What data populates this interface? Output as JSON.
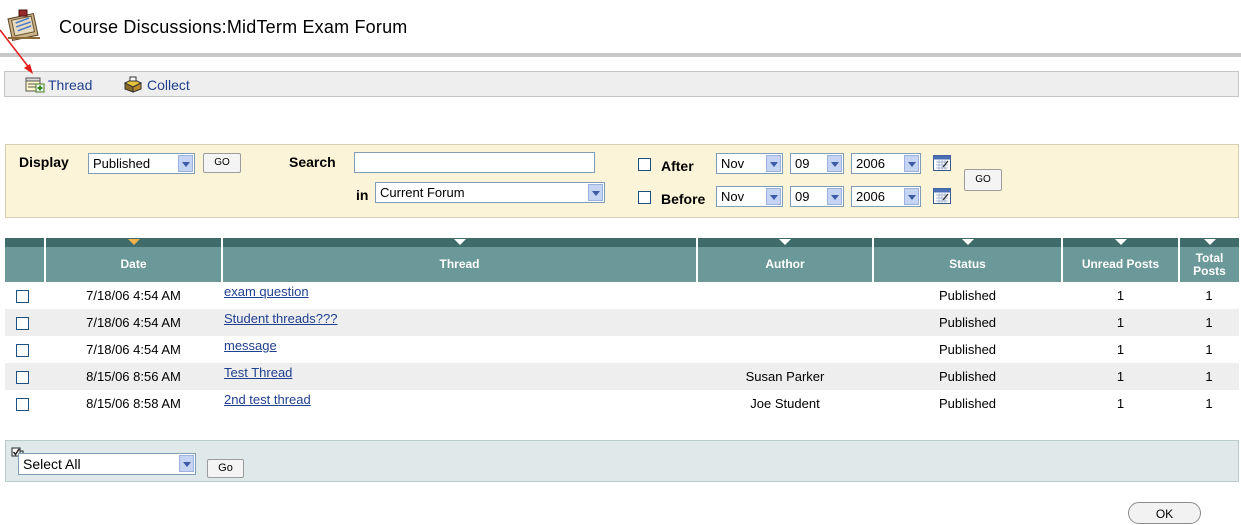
{
  "header": {
    "title": "Course Discussions:MidTerm Exam Forum"
  },
  "actions": {
    "thread_label": "Thread",
    "collect_label": "Collect"
  },
  "filter": {
    "display_label": "Display",
    "display_value": "Published",
    "display_go": "GO",
    "search_label": "Search",
    "search_value": "",
    "in_label": "in",
    "in_value": "Current Forum",
    "after_label": "After",
    "before_label": "Before",
    "after_month": "Nov",
    "after_day": "09",
    "after_year": "2006",
    "before_month": "Nov",
    "before_day": "09",
    "before_year": "2006",
    "date_go": "GO"
  },
  "table": {
    "columns": {
      "date": "Date",
      "thread": "Thread",
      "author": "Author",
      "status": "Status",
      "unread": "Unread Posts",
      "total": "Total Posts"
    },
    "rows": [
      {
        "date": "7/18/06 4:54 AM",
        "thread": "exam question",
        "author": "",
        "status": "Published",
        "unread": "1",
        "total": "1"
      },
      {
        "date": "7/18/06 4:54 AM",
        "thread": "Student threads???",
        "author": "",
        "status": "Published",
        "unread": "1",
        "total": "1"
      },
      {
        "date": "7/18/06 4:54 AM",
        "thread": "message",
        "author": "",
        "status": "Published",
        "unread": "1",
        "total": "1"
      },
      {
        "date": "8/15/06 8:56 AM",
        "thread": "Test Thread",
        "author": "Susan Parker",
        "status": "Published",
        "unread": "1",
        "total": "1"
      },
      {
        "date": "8/15/06 8:58 AM",
        "thread": "2nd test thread",
        "author": "Joe Student",
        "status": "Published",
        "unread": "1",
        "total": "1"
      }
    ]
  },
  "footer": {
    "select_value": "Select All",
    "go_label": "Go",
    "ok_label": "OK"
  },
  "colors": {
    "header_bg": "#6b9898",
    "header_arrow_bg": "#3f6b6b",
    "filter_bg": "#fcf4d8",
    "link": "#1f3f8f"
  }
}
